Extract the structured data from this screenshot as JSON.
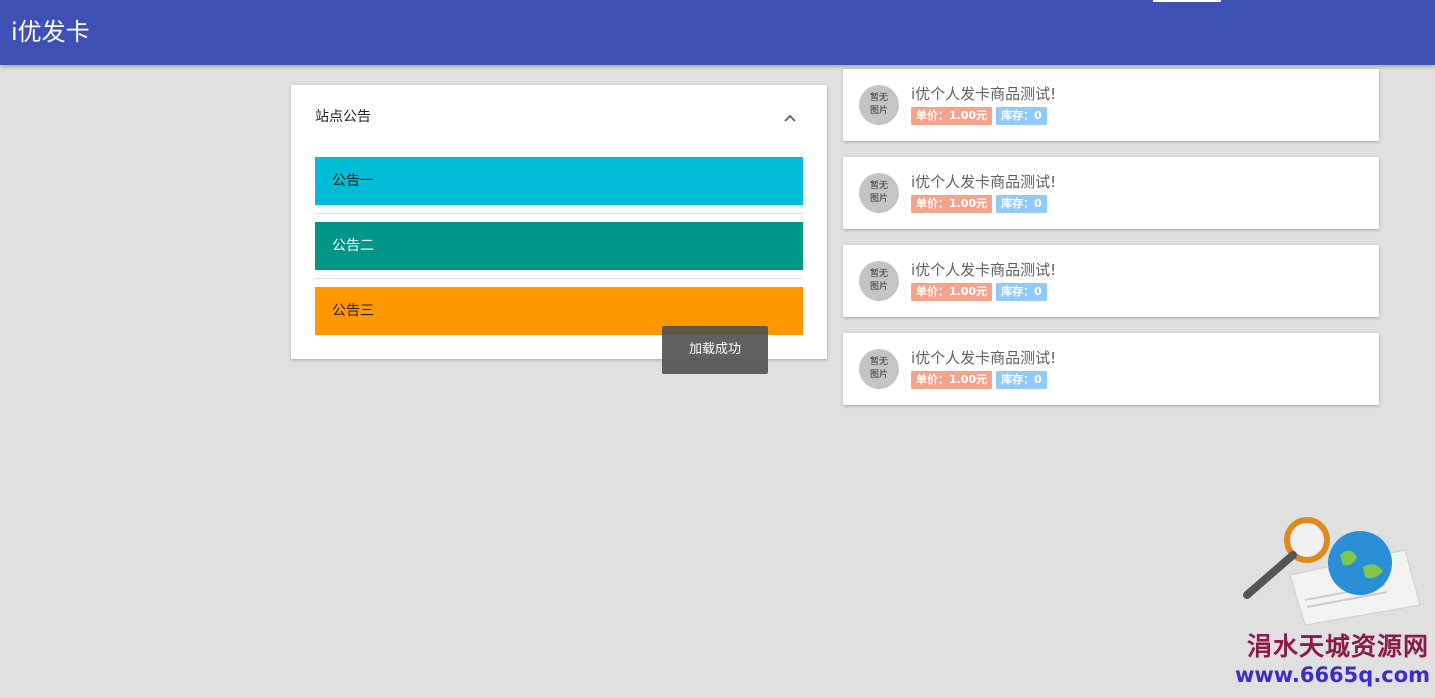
{
  "header": {
    "title": "i优发卡"
  },
  "notice": {
    "title": "站点公告",
    "items": [
      {
        "label": "公告一",
        "color": "#00bcd4"
      },
      {
        "label": "公告二",
        "color": "#009688"
      },
      {
        "label": "公告三",
        "color": "#ff9800"
      }
    ]
  },
  "toast": {
    "text": "加载成功"
  },
  "products": [
    {
      "thumb_line1": "暂无",
      "thumb_line2": "图片",
      "name": "i优个人发卡商品测试!",
      "price": "单价：1.00元",
      "stock": "库存：0"
    },
    {
      "thumb_line1": "暂无",
      "thumb_line2": "图片",
      "name": "i优个人发卡商品测试!",
      "price": "单价：1.00元",
      "stock": "库存：0"
    },
    {
      "thumb_line1": "暂无",
      "thumb_line2": "图片",
      "name": "i优个人发卡商品测试!",
      "price": "单价：1.00元",
      "stock": "库存：0"
    },
    {
      "thumb_line1": "暂无",
      "thumb_line2": "图片",
      "name": "i优个人发卡商品测试!",
      "price": "单价：1.00元",
      "stock": "库存：0"
    }
  ],
  "watermark": {
    "line1": "涓水天城资源网",
    "line2": "www.6665q.com"
  },
  "colors": {
    "primary": "#3f51b5",
    "background": "#e0e0e0",
    "price_badge": "#f4a38c",
    "stock_badge": "#90caf9"
  }
}
